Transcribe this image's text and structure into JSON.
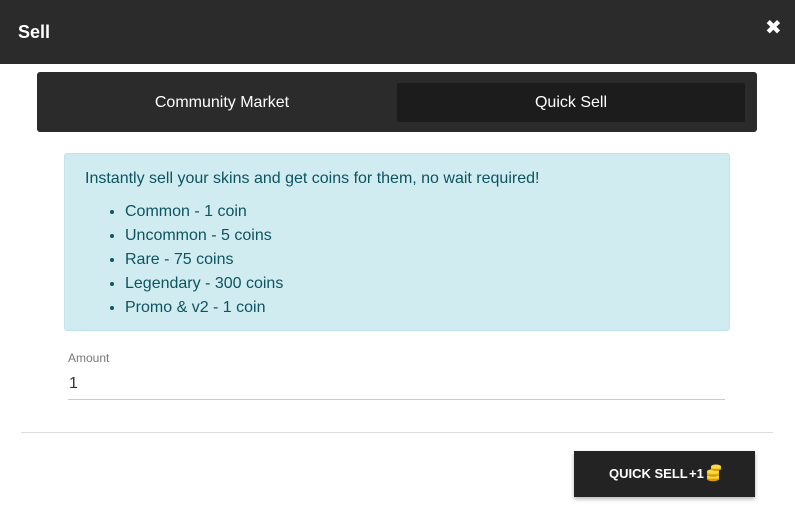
{
  "header": {
    "title": "Sell",
    "close_icon": "close-icon"
  },
  "tabs": [
    {
      "label": "Community Market",
      "active": false
    },
    {
      "label": "Quick Sell",
      "active": true
    }
  ],
  "info": {
    "intro": "Instantly sell your skins and get coins for them, no wait required!",
    "items": [
      "Common - 1 coin",
      "Uncommon - 5 coins",
      "Rare - 75 coins",
      "Legendary - 300 coins",
      "Promo & v2 - 1 coin"
    ]
  },
  "amount": {
    "label": "Amount",
    "value": "1"
  },
  "action": {
    "label": "QUICK SELL",
    "bonus": "+1",
    "icon": "coins-icon"
  },
  "colors": {
    "header_bg": "#2b2b2b",
    "info_bg": "#d1ecf1",
    "info_text": "#0c5460",
    "coin": "#f5c518"
  }
}
